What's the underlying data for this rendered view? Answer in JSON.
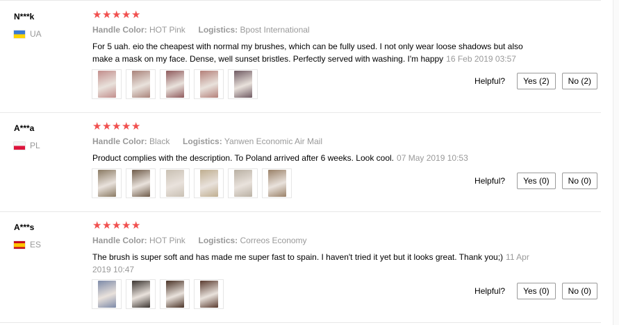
{
  "reviews": [
    {
      "user": "N***k",
      "country": "UA",
      "flag": "ukraine-flag",
      "rating": 5,
      "handle_label": "Handle Color:",
      "handle_value": "HOT Pink",
      "logistics_label": "Logistics:",
      "logistics_value": "Bpost International",
      "text": "For 5 uah. eio the cheapest with normal my brushes, which can be fully used. I not only wear loose shadows but also make a mask on my face. Dense, well sunset bristles. Perfectly served with washing. I'm happy",
      "date": "16 Feb 2019 03:57",
      "photos": [
        "#c28e8c",
        "#a9837a",
        "#8f5a5c",
        "#b48079",
        "#6f5a62"
      ],
      "helpful_label": "Helpful?",
      "yes_label": "Yes (2)",
      "no_label": "No (2)"
    },
    {
      "user": "A***a",
      "country": "PL",
      "flag": "poland-flag",
      "rating": 5,
      "handle_label": "Handle Color:",
      "handle_value": "Black",
      "logistics_label": "Logistics:",
      "logistics_value": "Yanwen Economic Air Mail",
      "text": "Product complies with the description. To Poland arrived after 6 weeks. Look cool.",
      "date": "07 May 2019 10:53",
      "photos": [
        "#8a7a63",
        "#6f5c4a",
        "#c9c0b3",
        "#bfae90",
        "#b9b0a3",
        "#9a8168"
      ],
      "helpful_label": "Helpful?",
      "yes_label": "Yes (0)",
      "no_label": "No (0)"
    },
    {
      "user": "A***s",
      "country": "ES",
      "flag": "spain-flag",
      "rating": 5,
      "handle_label": "Handle Color:",
      "handle_value": "HOT Pink",
      "logistics_label": "Logistics:",
      "logistics_value": "Correos Economy",
      "text": "The brush is super soft and has made me super fast to spain. I haven't tried it yet but it looks great. Thank you;)",
      "date": "11 Apr 2019 10:47",
      "photos": [
        "#7d8aa8",
        "#3b3531",
        "#4a3327",
        "#5a3b2f"
      ],
      "helpful_label": "Helpful?",
      "yes_label": "Yes (0)",
      "no_label": "No (0)"
    }
  ]
}
